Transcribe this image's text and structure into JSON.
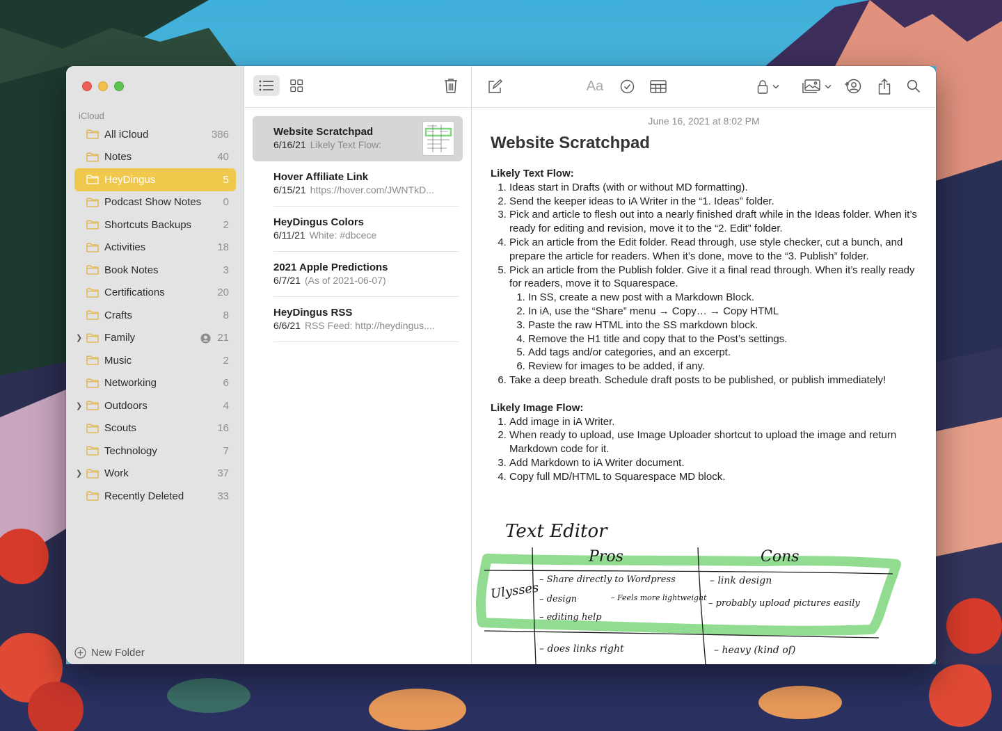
{
  "sidebar": {
    "section_label": "iCloud",
    "folders": [
      {
        "name": "All iCloud",
        "count": "386"
      },
      {
        "name": "Notes",
        "count": "40"
      },
      {
        "name": "HeyDingus",
        "count": "5"
      },
      {
        "name": "Podcast Show Notes",
        "count": "0"
      },
      {
        "name": "Shortcuts Backups",
        "count": "2"
      },
      {
        "name": "Activities",
        "count": "18"
      },
      {
        "name": "Book Notes",
        "count": "3"
      },
      {
        "name": "Certifications",
        "count": "20"
      },
      {
        "name": "Crafts",
        "count": "8"
      },
      {
        "name": "Family",
        "count": "21"
      },
      {
        "name": "Music",
        "count": "2"
      },
      {
        "name": "Networking",
        "count": "6"
      },
      {
        "name": "Outdoors",
        "count": "4"
      },
      {
        "name": "Scouts",
        "count": "16"
      },
      {
        "name": "Technology",
        "count": "7"
      },
      {
        "name": "Work",
        "count": "37"
      },
      {
        "name": "Recently Deleted",
        "count": "33"
      }
    ],
    "new_folder_label": "New Folder"
  },
  "note_list": {
    "notes": [
      {
        "title": "Website Scratchpad",
        "date": "6/16/21",
        "snippet": "Likely Text Flow:"
      },
      {
        "title": "Hover Affiliate Link",
        "date": "6/15/21",
        "snippet": "https://hover.com/JWNTkD..."
      },
      {
        "title": "HeyDingus Colors",
        "date": "6/11/21",
        "snippet": "White: #dbcece"
      },
      {
        "title": "2021 Apple Predictions",
        "date": "6/7/21",
        "snippet": "(As of 2021-06-07)"
      },
      {
        "title": "HeyDingus RSS",
        "date": "6/6/21",
        "snippet": "RSS Feed: http://heydingus...."
      }
    ]
  },
  "editor": {
    "format_button_label": "Aa",
    "date": "June 16, 2021 at 8:02 PM",
    "title": "Website Scratchpad",
    "text_flow_heading": "Likely Text Flow:",
    "text_flow": [
      "Ideas start in Drafts (with or without MD formatting).",
      "Send the keeper ideas to iA Writer in the “1. Ideas” folder.",
      "Pick and article to flesh out into a nearly finished draft while in the Ideas folder. When it’s ready for editing and revision, move it to the “2. Edit” folder.",
      "Pick an article from the Edit folder. Read through, use style checker, cut a bunch, and prepare the article for readers. When it’s done, move to the “3. Publish” folder.",
      "Pick an article from the Publish folder. Give it a final read through. When it’s really ready for readers, move it to Squarespace.",
      "Take a deep breath. Schedule draft posts to be published, or publish immediately!"
    ],
    "text_flow_sub": [
      "In SS, create a new post with a Markdown Block.",
      "In iA, use the “Share” menu → Copy… → Copy HTML",
      "Paste the raw HTML into the SS markdown block.",
      "Remove the H1 title and copy that to the Post’s settings.",
      "Add tags and/or categories, and an excerpt.",
      "Review for images to be added, if any."
    ],
    "image_flow_heading": "Likely Image Flow:",
    "image_flow": [
      "Add image in iA Writer.",
      "When ready to upload, use Image Uploader shortcut to upload the image and return Markdown code for it.",
      "Add Markdown to iA Writer document.",
      "Copy full MD/HTML to Squarespace MD block."
    ],
    "sketch": {
      "heading": "Text Editor",
      "col_pros": "Pros",
      "col_cons": "Cons",
      "row1_label": "Ulysses",
      "row1_pros_a": "– Share directly to Wordpress",
      "row1_pros_b": "– design",
      "row1_pros_c": "– Feels more lightweight",
      "row1_pros_d": "– editing help",
      "row1_cons_a": "– link design",
      "row1_cons_b": "– probably upload pictures easily",
      "row2_pros": "– does links right",
      "row2_cons": "– heavy (kind of)",
      "highlight_color": "#7ed67e"
    }
  },
  "colors": {
    "accent": "#f0c84b",
    "folder_icon": "#e2b13c"
  }
}
